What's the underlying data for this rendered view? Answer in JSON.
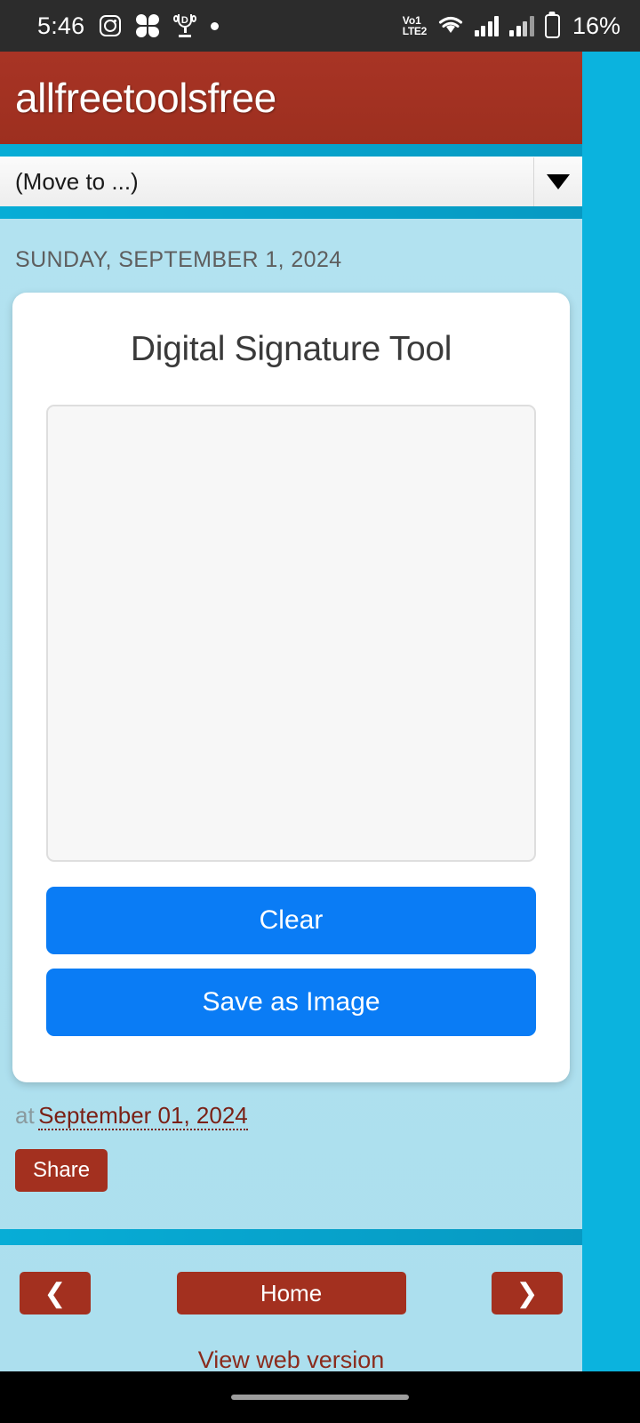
{
  "status_bar": {
    "time": "5:46",
    "left_icons": [
      "instagram-icon",
      "flower-icon",
      "trophy-icon",
      "dot-icon"
    ],
    "network": {
      "volte_line1": "Vo1",
      "volte_line2": "LTE2"
    },
    "right_icons": [
      "wifi-icon",
      "signal-bars-sim1-icon",
      "signal-bars-sim2-icon",
      "battery-icon"
    ],
    "battery_percent": "16%"
  },
  "blog": {
    "title": "allfreetoolsfree",
    "move_to_label": "(Move to ...)",
    "date_header": "SUNDAY, SEPTEMBER 1, 2024"
  },
  "tool": {
    "title": "Digital Signature Tool",
    "canvas_placeholder": "",
    "clear_label": "Clear",
    "save_label": "Save as Image"
  },
  "post_footer": {
    "at_label": "at",
    "date": "September 01, 2024",
    "share_label": "Share"
  },
  "navigation": {
    "prev_label": "❮",
    "home_label": "Home",
    "next_label": "❯",
    "web_version_label": "View web version"
  },
  "colors": {
    "header_red": "#A83425",
    "accent_cyan": "#0BB3DE",
    "body_blue": "#B3E2F0",
    "button_blue": "#0A7CF5",
    "dark_red": "#A3301F",
    "status_bar": "#2C2C2C"
  }
}
